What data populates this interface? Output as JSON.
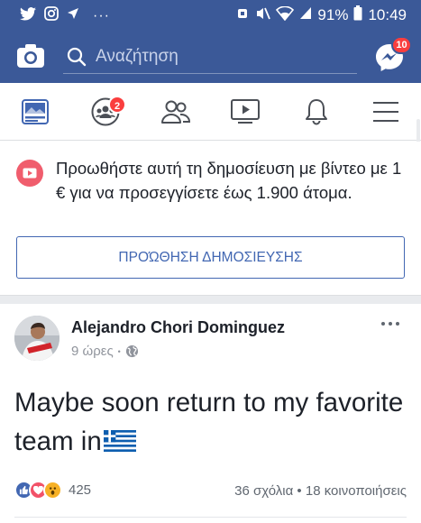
{
  "status_bar": {
    "battery": "91%",
    "time": "10:49",
    "dots": "···"
  },
  "top_bar": {
    "search_placeholder": "Αναζήτηση",
    "messenger_badge": "10"
  },
  "tabs": [
    {
      "name": "news-feed",
      "icon": "news-feed-icon",
      "badge": ""
    },
    {
      "name": "groups",
      "icon": "groups-icon",
      "badge": "2"
    },
    {
      "name": "friends",
      "icon": "friends-icon",
      "badge": ""
    },
    {
      "name": "watch",
      "icon": "video-icon",
      "badge": ""
    },
    {
      "name": "notifications",
      "icon": "bell-icon",
      "badge": ""
    },
    {
      "name": "menu",
      "icon": "hamburger-icon",
      "badge": ""
    }
  ],
  "promo": {
    "text": "Προωθήστε αυτή τη δημοσίευση με βίντεο με 1 € για να προσεγγίσετε έως 1.900 άτομα.",
    "button_label": "ΠΡΟΏΘΗΣΗ ΔΗΜΟΣΙΕΥΣΗΣ"
  },
  "post": {
    "author": "Alejandro Chori Dominguez",
    "time": "9 ώρες",
    "dot": "•",
    "text": "Maybe soon return to my favorite team in",
    "reaction_count": "425",
    "comments": "36 σχόλια",
    "stats_sep": " • ",
    "shares": "18 κοινοποιήσεις"
  },
  "colors": {
    "brand": "#3b5998",
    "link_blue": "#4267b2",
    "badge_red": "#fa3e3e"
  }
}
